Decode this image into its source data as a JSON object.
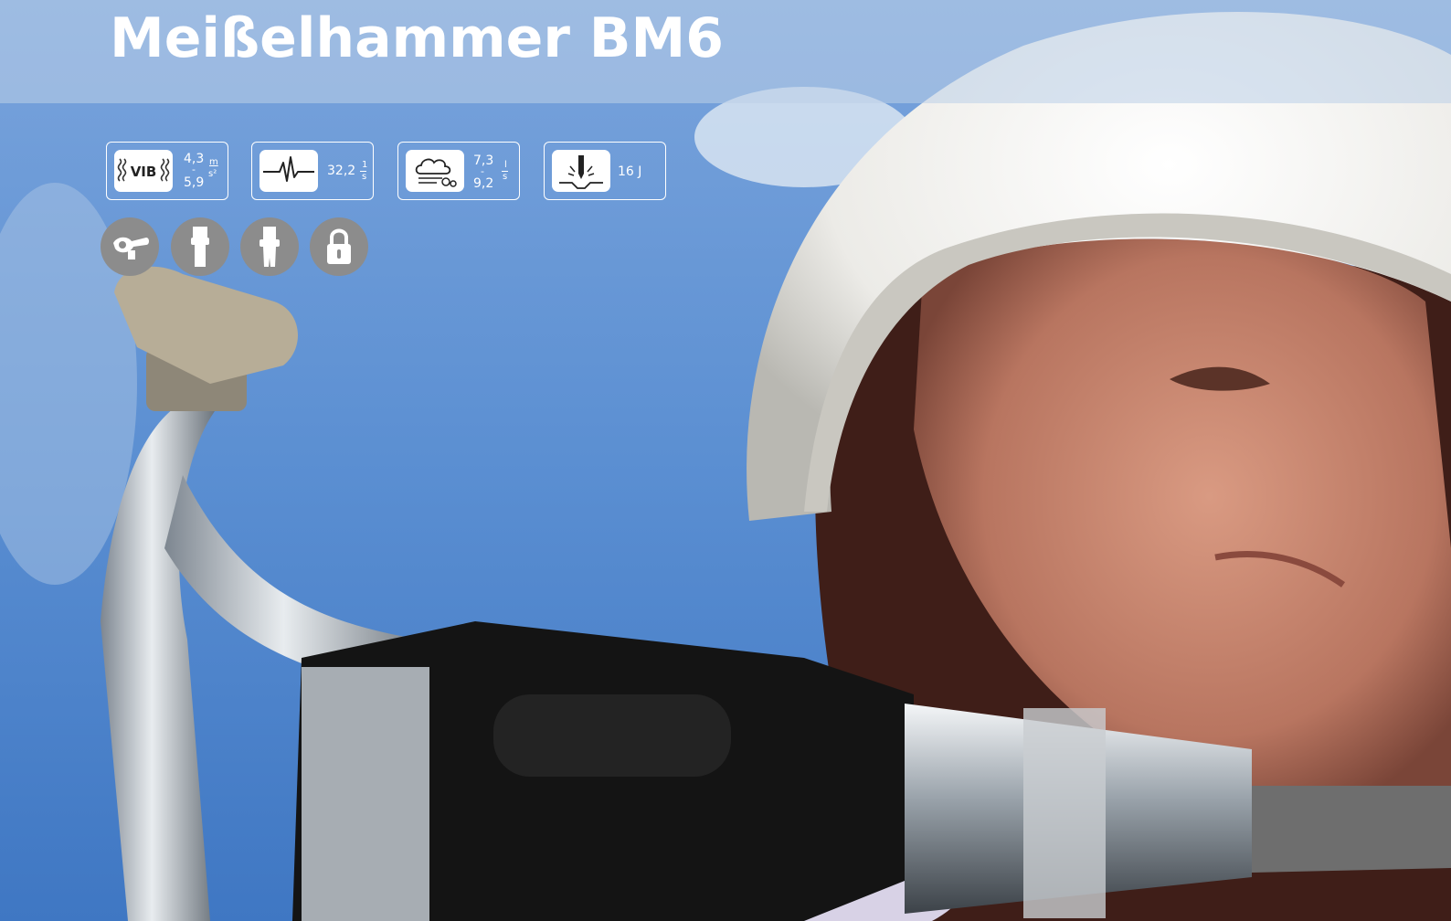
{
  "title": "Meißelhammer BM6",
  "specs": {
    "vibration": {
      "icon": "vibration-icon",
      "icon_text": "VIB",
      "value_low": "4,3",
      "value_high": "5,9",
      "unit_top": "m",
      "unit_bottom": "s²"
    },
    "frequency": {
      "icon": "impact-frequency-icon",
      "value": "32,2",
      "unit_top": "1",
      "unit_bottom": "s"
    },
    "air_consumption": {
      "icon": "air-consumption-icon",
      "value_low": "7,3",
      "value_high": "9,2",
      "unit_top": "l",
      "unit_bottom": "s"
    },
    "impact_energy": {
      "icon": "impact-energy-icon",
      "value": "16 J"
    }
  },
  "features": [
    {
      "icon": "air-coupling-icon"
    },
    {
      "icon": "hex-shank-icon"
    },
    {
      "icon": "collar-shank-icon"
    },
    {
      "icon": "lock-icon"
    }
  ]
}
